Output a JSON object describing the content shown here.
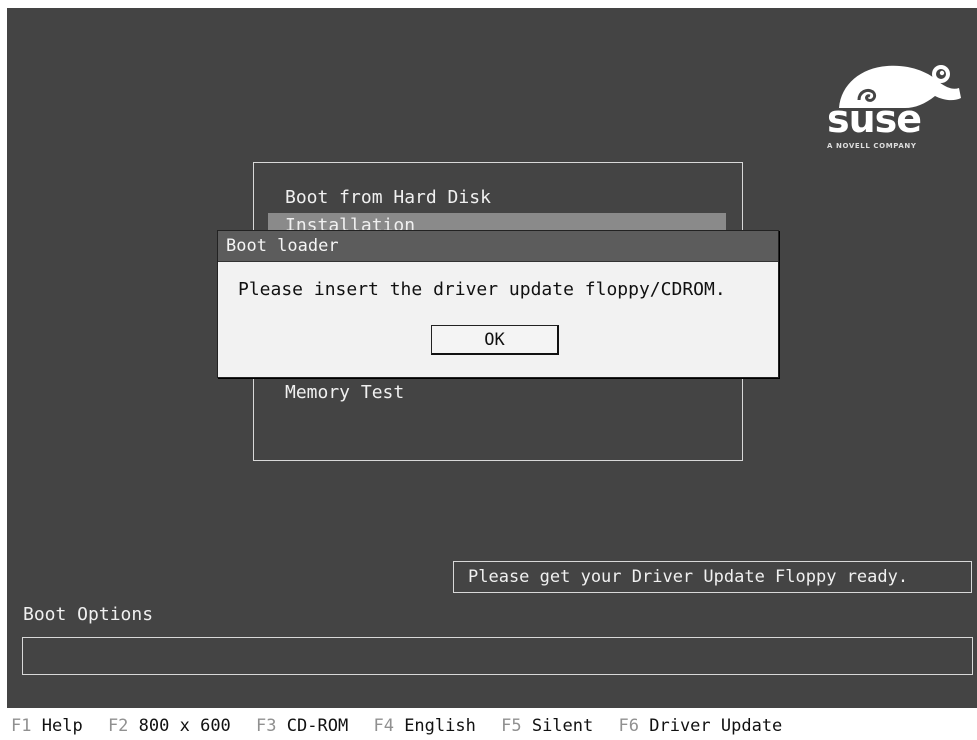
{
  "logo": {
    "brand": "suse",
    "tagline": "A NOVELL COMPANY"
  },
  "boot_menu": {
    "items": [
      {
        "label": "Boot from Hard Disk",
        "selected": false
      },
      {
        "label": "Installation",
        "selected": true
      },
      {
        "label": "Memory Test",
        "selected": false
      }
    ]
  },
  "dialog": {
    "title": "Boot loader",
    "message": "Please insert the driver update floppy/CDROM.",
    "ok_label": "OK"
  },
  "status_hint": "Please get your Driver Update Floppy ready.",
  "boot_options": {
    "label": "Boot Options",
    "value": ""
  },
  "function_keys": [
    {
      "key": "F1",
      "label": "Help"
    },
    {
      "key": "F2",
      "label": "800 x 600"
    },
    {
      "key": "F3",
      "label": "CD-ROM"
    },
    {
      "key": "F4",
      "label": "English"
    },
    {
      "key": "F5",
      "label": "Silent"
    },
    {
      "key": "F6",
      "label": "Driver Update"
    }
  ],
  "colors": {
    "screen_background": "#444444",
    "selection_highlight": "#8a8a8a",
    "dialog_title_bar": "#5c5c5c",
    "dialog_body": "#f2f2f2"
  }
}
